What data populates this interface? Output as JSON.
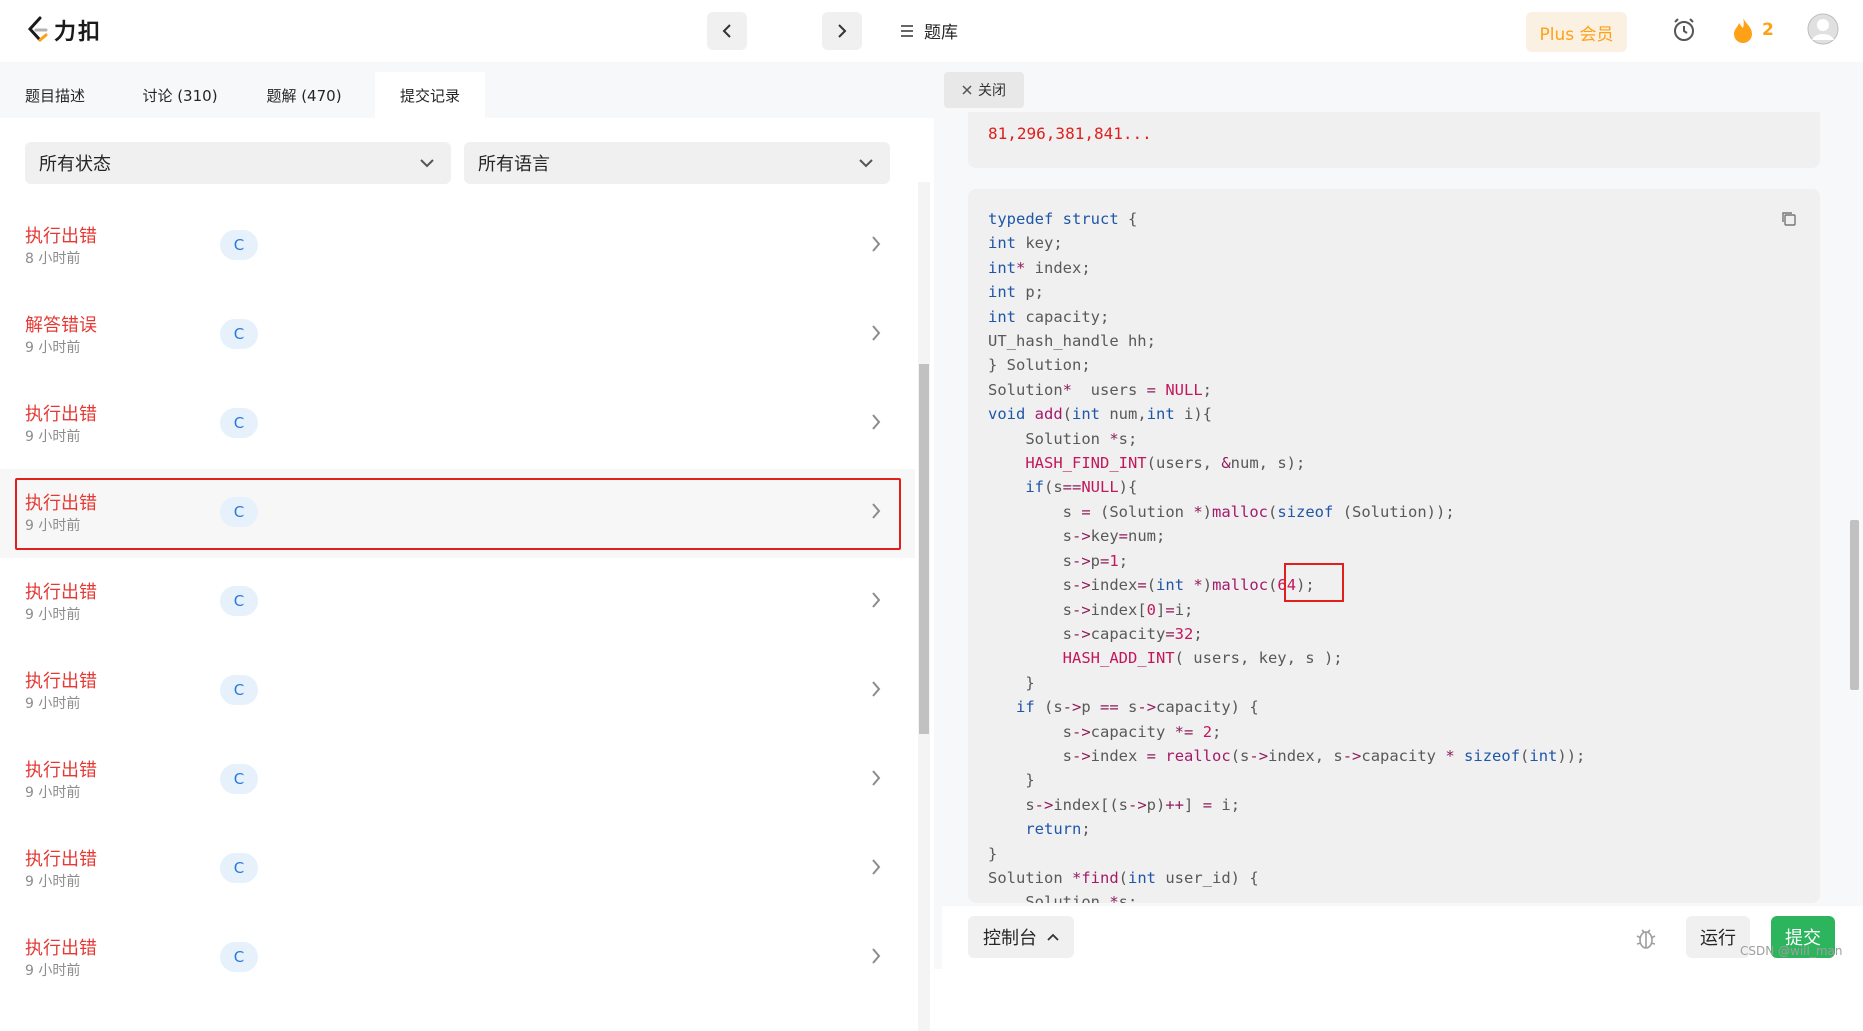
{
  "app": {
    "logo_text": "力扣"
  },
  "header": {
    "problemset_label": "题库",
    "plus_label": "Plus 会员",
    "streak_count": "2"
  },
  "tabs": [
    {
      "label": "题目描述"
    },
    {
      "label": "讨论 (310)"
    },
    {
      "label": "题解 (470)"
    },
    {
      "label": "提交记录"
    }
  ],
  "filters": {
    "status": "所有状态",
    "language": "所有语言"
  },
  "submissions": [
    {
      "status": "执行出错",
      "time": "8 小时前",
      "lang": "C"
    },
    {
      "status": "解答错误",
      "time": "9 小时前",
      "lang": "C"
    },
    {
      "status": "执行出错",
      "time": "9 小时前",
      "lang": "C"
    },
    {
      "status": "执行出错",
      "time": "9 小时前",
      "lang": "C"
    },
    {
      "status": "执行出错",
      "time": "9 小时前",
      "lang": "C"
    },
    {
      "status": "执行出错",
      "time": "9 小时前",
      "lang": "C"
    },
    {
      "status": "执行出错",
      "time": "9 小时前",
      "lang": "C"
    },
    {
      "status": "执行出错",
      "time": "9 小时前",
      "lang": "C"
    },
    {
      "status": "执行出错",
      "time": "9 小时前",
      "lang": "C"
    }
  ],
  "detail": {
    "close_label": "关闭",
    "result_text": "81,296,381,841..."
  },
  "bottom": {
    "console_label": "控制台",
    "run_label": "运行",
    "submit_label": "提交"
  },
  "watermark": "CSDN @will_man",
  "colors": {
    "accent": "#ffa116",
    "error": "#e53935",
    "submit": "#2db55d",
    "highlight_box": "#e0201c"
  }
}
